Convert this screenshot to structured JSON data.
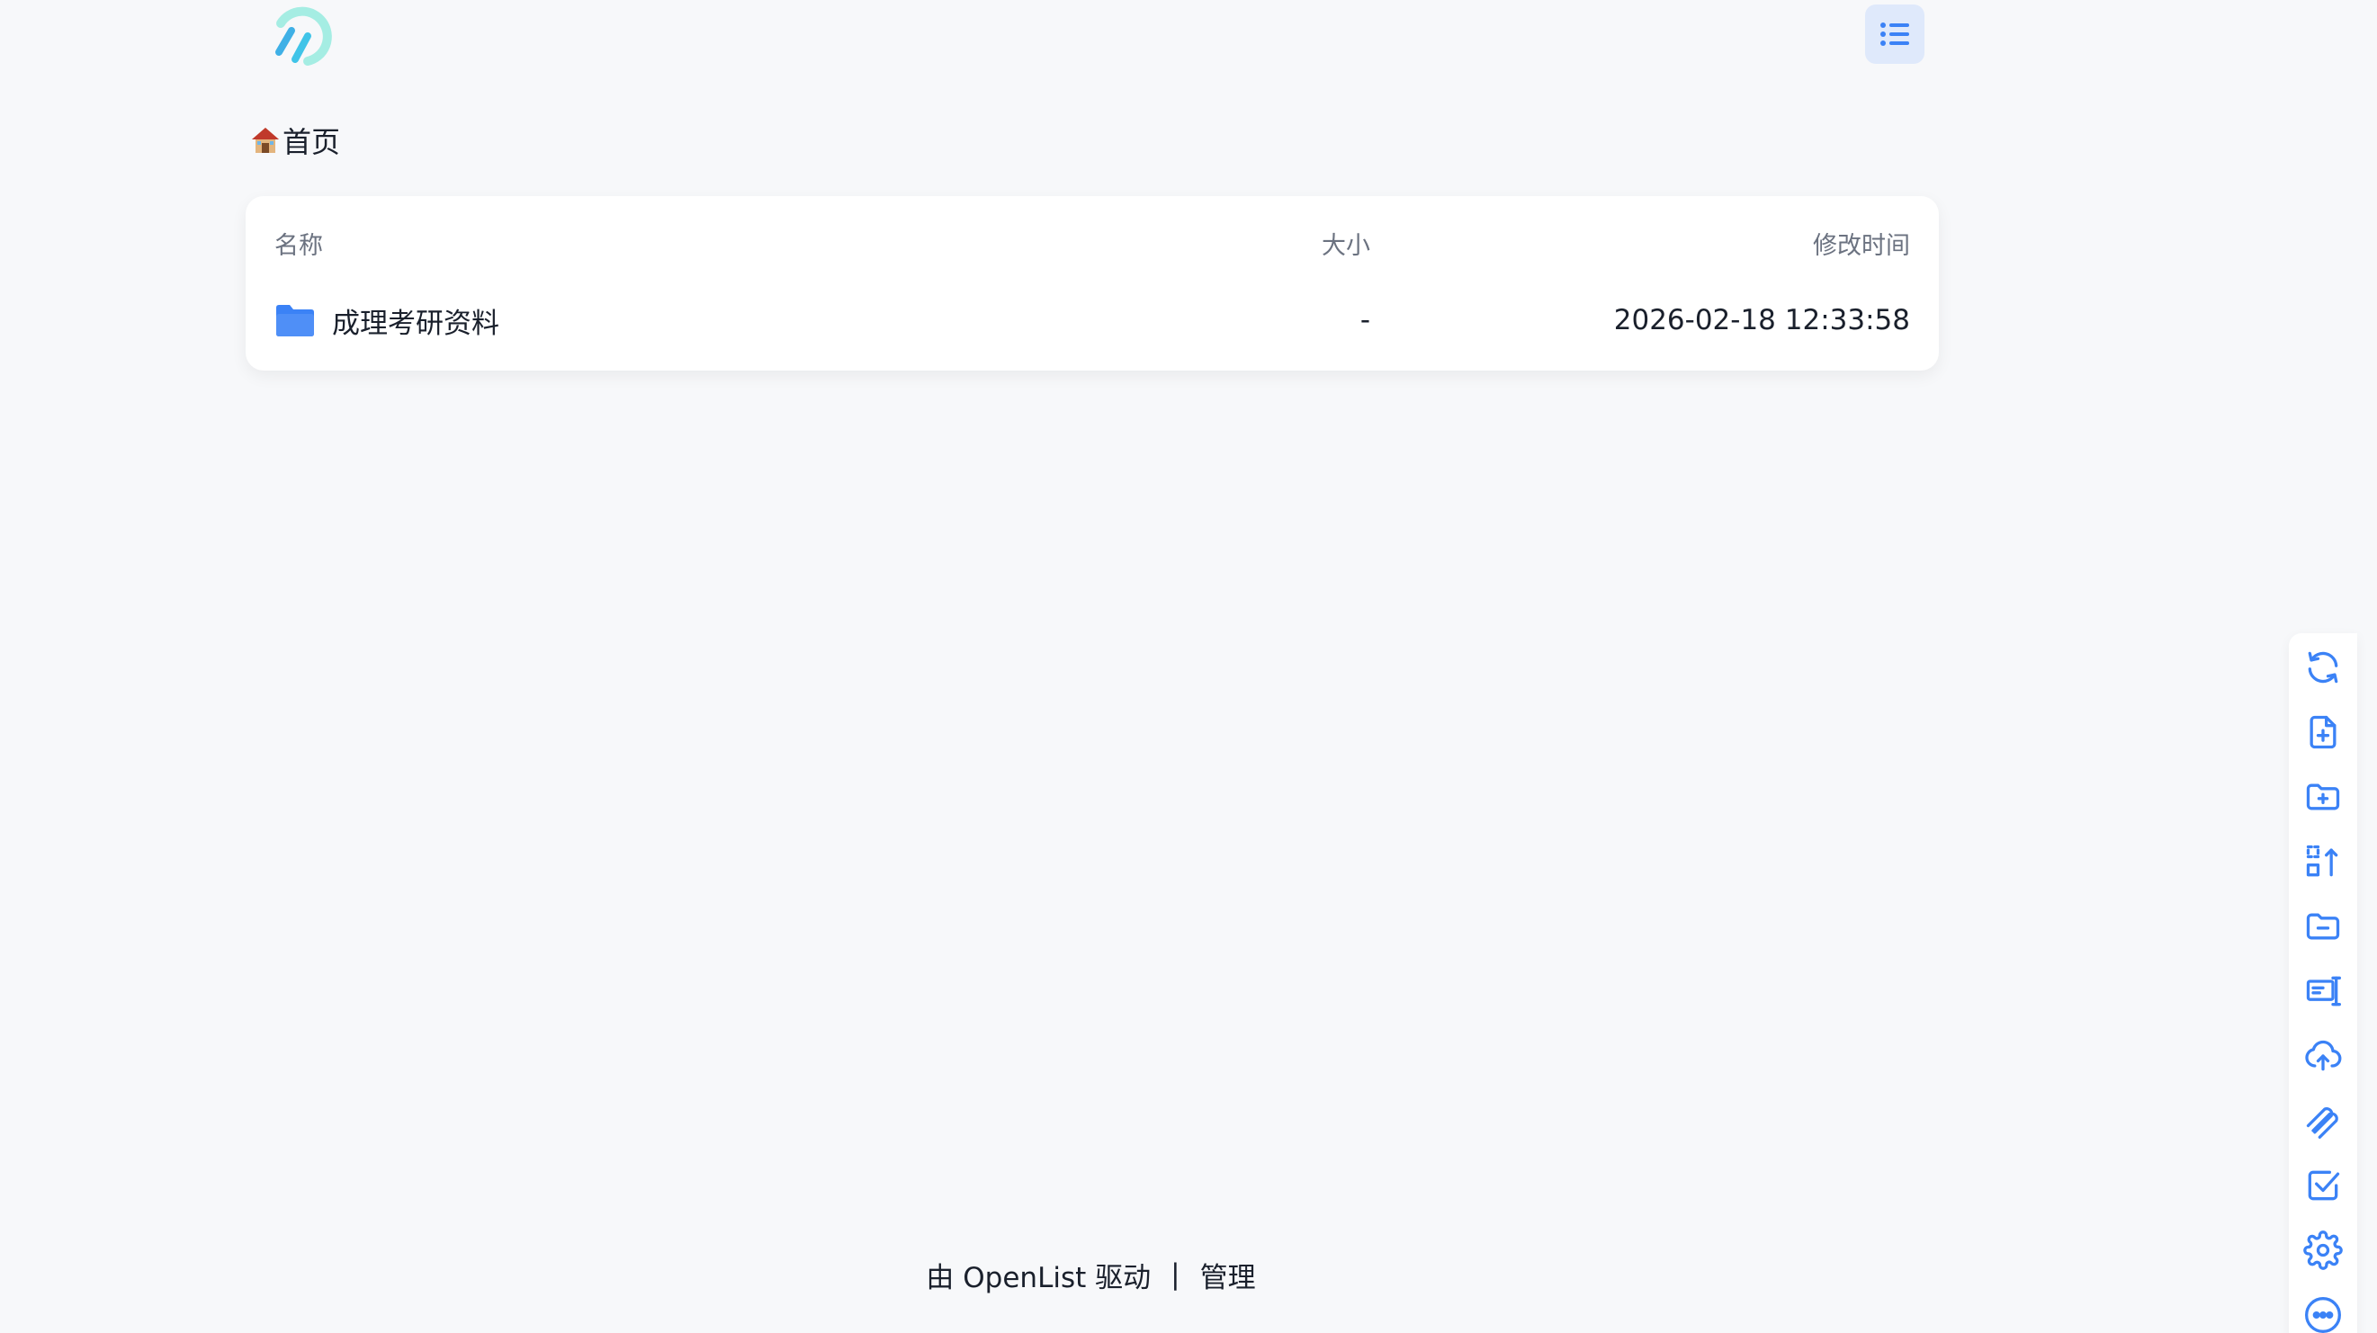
{
  "breadcrumb": {
    "home_label": "首页"
  },
  "table": {
    "columns": {
      "name": "名称",
      "size": "大小",
      "modified": "修改时间"
    },
    "rows": [
      {
        "name": "成理考研资料",
        "size": "-",
        "modified": "2026-02-18 12:33:58",
        "icon": "folder-icon"
      }
    ]
  },
  "footer": {
    "powered_by": "由 OpenList 驱动",
    "separator": "|",
    "manage": "管理"
  },
  "toolbar": {
    "tools": [
      "refresh-icon",
      "new-file-icon",
      "new-folder-icon",
      "sort-icon",
      "remove-folder-icon",
      "local-settings-icon",
      "upload-icon",
      "offline-download-icon",
      "select-icon",
      "settings-icon",
      "more-icon"
    ]
  },
  "colors": {
    "accent": "#3b82f6",
    "background": "#f7f8fa",
    "card": "#ffffff",
    "logo_primary": "#40c4e8",
    "logo_secondary": "#a5ede3"
  }
}
